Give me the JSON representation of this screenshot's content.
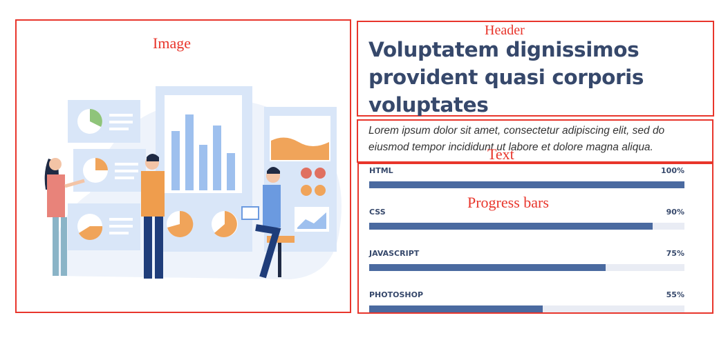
{
  "annotations": {
    "image_label": "Image",
    "header_label": "Header",
    "text_label": "Text",
    "progress_label": "Progress bars",
    "box_color": "#e8352b"
  },
  "header": {
    "title": "Voluptatem dignissimos provident quasi corporis voluptates"
  },
  "text": {
    "body": "Lorem ipsum dolor sit amet, consectetur adipiscing elit, sed do eiusmod tempor incididunt ut labore et dolore magna aliqua."
  },
  "skills": [
    {
      "name": "HTML",
      "value_label": "100%",
      "percent": 100
    },
    {
      "name": "CSS",
      "value_label": "90%",
      "percent": 90
    },
    {
      "name": "JAVASCRIPT",
      "value_label": "75%",
      "percent": 75
    },
    {
      "name": "PHOTOSHOP",
      "value_label": "55%",
      "percent": 55
    }
  ],
  "colors": {
    "heading": "#36486b",
    "bar_fill": "#4a6aa0",
    "bar_track": "#e9ecf4"
  }
}
